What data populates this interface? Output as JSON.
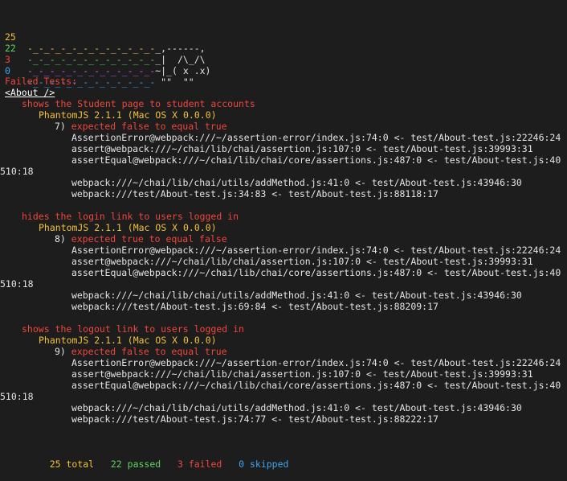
{
  "banner": {
    "counts": [
      "25",
      "22",
      "3",
      "0"
    ],
    "count_colors": [
      "#f2c13a",
      "#5fd35f",
      "#f0463c",
      "#3ea3f2"
    ],
    "trail": [
      "-_-_-_-_-_-_-_-_-_-_-_-",
      "-_-_-_-_-_-_-_-_-_-_-_-",
      "-_-_-_-_-_-_-_-_-_-_-_-",
      "-_-_-_-_-_-_-_-_-_-_-_-"
    ],
    "cat": [
      "_,------,",
      "_|  /\\_/\\",
      "~|_( x .x)",
      " \"\"  \"\""
    ]
  },
  "failed_header": "Failed Tests:",
  "suite_name": "<About />",
  "failures": [
    {
      "title": "shows the Student page to student accounts",
      "browser": "PhantomJS 2.1.1 (Mac OS X 0.0.0)",
      "number": "7)",
      "message": "expected false to equal true",
      "stack": [
        "AssertionError@webpack:///~/assertion-error/index.js:74:0 <- test/About-test.js:22246:24",
        "assert@webpack:///~/chai/lib/chai/assertion.js:107:0 <- test/About-test.js:39993:31",
        "assertEqual@webpack:///~/chai/lib/chai/core/assertions.js:487:0 <- test/About-test.js:40",
        "510:18",
        "webpack:///~/chai/lib/chai/utils/addMethod.js:41:0 <- test/About-test.js:43946:30",
        "webpack:///test/About-test.js:34:83 <- test/About-test.js:88118:17"
      ]
    },
    {
      "title": "hides the login link to users logged in",
      "browser": "PhantomJS 2.1.1 (Mac OS X 0.0.0)",
      "number": "8)",
      "message": "expected true to equal false",
      "stack": [
        "AssertionError@webpack:///~/assertion-error/index.js:74:0 <- test/About-test.js:22246:24",
        "assert@webpack:///~/chai/lib/chai/assertion.js:107:0 <- test/About-test.js:39993:31",
        "assertEqual@webpack:///~/chai/lib/chai/core/assertions.js:487:0 <- test/About-test.js:40",
        "510:18",
        "webpack:///~/chai/lib/chai/utils/addMethod.js:41:0 <- test/About-test.js:43946:30",
        "webpack:///test/About-test.js:69:84 <- test/About-test.js:88209:17"
      ]
    },
    {
      "title": "shows the logout link to users logged in",
      "browser": "PhantomJS 2.1.1 (Mac OS X 0.0.0)",
      "number": "9)",
      "message": "expected false to equal true",
      "stack": [
        "AssertionError@webpack:///~/assertion-error/index.js:74:0 <- test/About-test.js:22246:24",
        "assert@webpack:///~/chai/lib/chai/assertion.js:107:0 <- test/About-test.js:39993:31",
        "assertEqual@webpack:///~/chai/lib/chai/core/assertions.js:487:0 <- test/About-test.js:40",
        "510:18",
        "webpack:///~/chai/lib/chai/utils/addMethod.js:41:0 <- test/About-test.js:43946:30",
        "webpack:///test/About-test.js:74:77 <- test/About-test.js:88222:17"
      ]
    }
  ],
  "summary": {
    "total": "25 total",
    "passed": "22 passed",
    "failed": "3 failed",
    "skipped": "0 skipped"
  }
}
